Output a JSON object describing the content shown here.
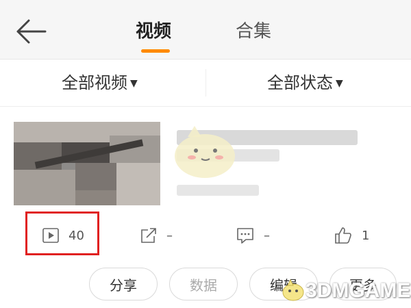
{
  "header": {
    "tabs": [
      {
        "label": "视频",
        "active": true
      },
      {
        "label": "合集",
        "active": false
      }
    ]
  },
  "filters": {
    "video_filter": "全部视频",
    "status_filter": "全部状态"
  },
  "video_item": {
    "stats": {
      "plays": "40",
      "shares": "–",
      "comments": "–",
      "likes": "1"
    },
    "actions": {
      "share": "分享",
      "data": "数据",
      "edit": "编辑",
      "more": "更多"
    }
  },
  "watermark": "3DMGAME",
  "colors": {
    "accent": "#ff8a00",
    "highlight": "#e02020",
    "header_bg": "#f6f6f6"
  },
  "icons": [
    "back-arrow-icon",
    "play-icon",
    "share-out-icon",
    "comment-icon",
    "thumbs-up-icon",
    "caret-down-icon"
  ]
}
